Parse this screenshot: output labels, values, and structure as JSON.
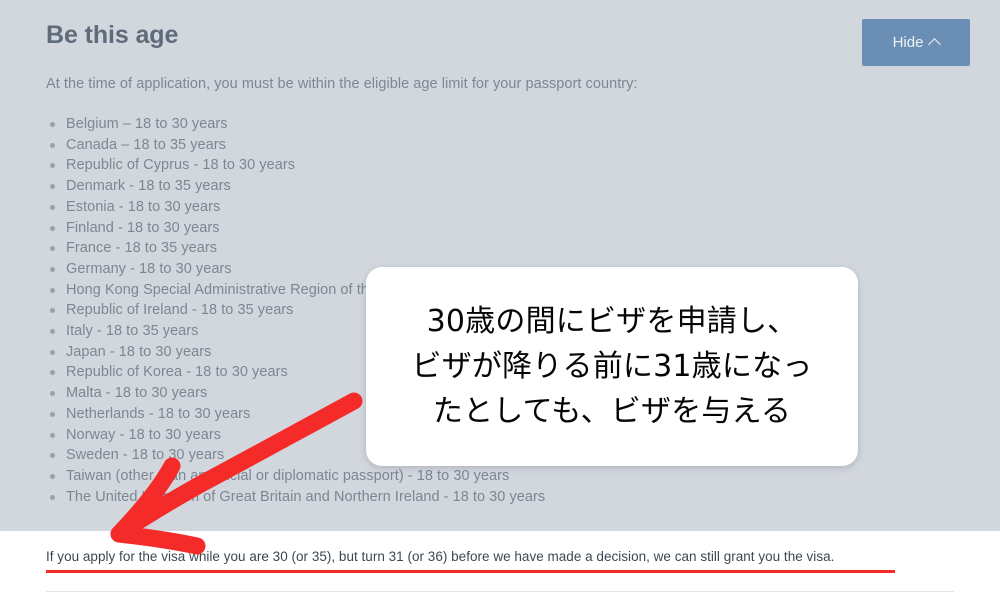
{
  "panel": {
    "title": "Be this age",
    "hide_button": {
      "label": "Hide",
      "icon": "chevron-up-icon"
    },
    "intro": "At the time of application, you must be within the eligible age limit for your passport country:",
    "countries": [
      "Belgium – 18 to 30 years",
      "Canada – 18 to 35 years",
      "Republic of Cyprus - 18 to 30 years",
      "Denmark - 18 to 35 years",
      "Estonia - 18 to 30 years",
      "Finland - 18 to 30 years",
      "France - 18 to 35 years",
      "Germany - 18 to 30 years",
      "Hong Kong Special Administrative Region of the People's Republic of China (passport holders) - 18 to 30 years",
      "Republic of Ireland - 18 to 35 years",
      "Italy - 18 to 35 years",
      "Japan - 18 to 30 years",
      "Republic of Korea - 18 to 30 years",
      "Malta - 18 to 30 years",
      "Netherlands - 18 to 30 years",
      "Norway - 18 to 30 years",
      "Sweden - 18 to 30 years",
      "Taiwan (other than an official or diplomatic passport) - 18 to 30 years",
      "The United Kingdom of Great Britain and Northern Ireland - 18 to 30 years"
    ]
  },
  "note": {
    "text": "If you apply for the visa while you are 30 (or 35), but turn 31 (or 36) before we have made a decision, we can still grant you the visa."
  },
  "annotation": {
    "tooltip_text": "30歳の間にビザを申請し、\nビザが降りる前に31歳になっ\nたとしても、ビザを与える",
    "arrow_color": "#f42b29",
    "highlight_color": "#f42b29"
  },
  "colors": {
    "panel_background": "#d2d7dd",
    "page_background": "#ffffff",
    "title_text": "#5f6b7a",
    "body_text": "#7c8694",
    "note_text": "#3d4754",
    "button_background": "#6b8fb4",
    "button_text": "#eef2f6"
  }
}
